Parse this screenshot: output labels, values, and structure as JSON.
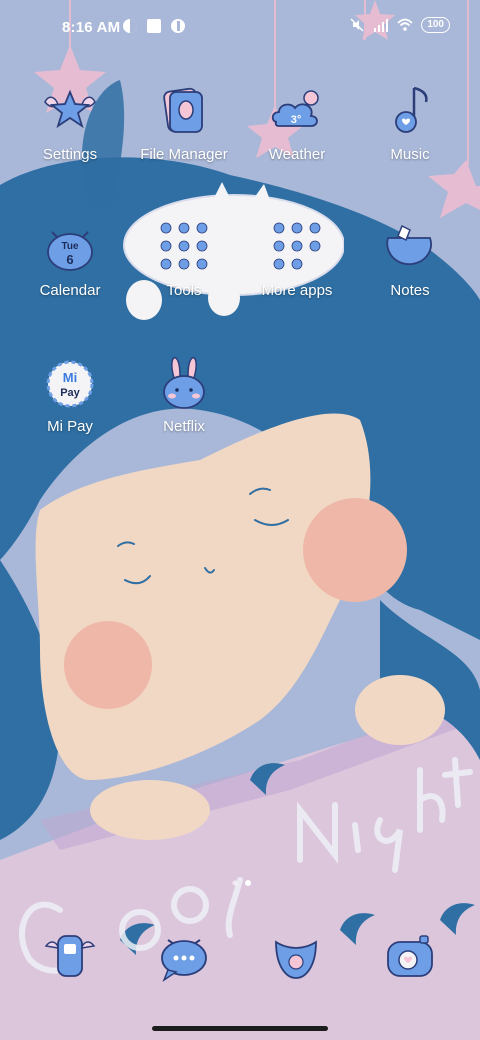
{
  "status_bar": {
    "time": "8:16 AM",
    "battery": "100"
  },
  "apps": [
    {
      "label": "Settings",
      "icon": "wing-star-icon"
    },
    {
      "label": "File Manager",
      "icon": "file-manager-icon"
    },
    {
      "label": "Weather",
      "icon": "weather-cloud-icon",
      "temp": "3°"
    },
    {
      "label": "Music",
      "icon": "music-note-icon"
    },
    {
      "label": "Calendar",
      "icon": "calendar-icon",
      "day": "Tue",
      "date": "6"
    },
    {
      "label": "Tools",
      "icon": "tools-folder-icon"
    },
    {
      "label": "More apps",
      "icon": "more-apps-folder-icon"
    },
    {
      "label": "Notes",
      "icon": "notes-cloud-icon"
    },
    {
      "label": "Mi Pay",
      "icon": "mi-pay-icon",
      "mi": "Mi",
      "pay": "Pay"
    },
    {
      "label": "Netflix",
      "icon": "bunny-icon"
    }
  ],
  "dock": [
    {
      "name": "phone",
      "icon": "phone-icon"
    },
    {
      "name": "messages",
      "icon": "message-bubble-icon"
    },
    {
      "name": "browser",
      "icon": "browser-bib-icon"
    },
    {
      "name": "camera",
      "icon": "camera-icon"
    }
  ],
  "wallpaper_text": "Good Night",
  "colors": {
    "sky": "#a9b8d8",
    "hair": "#2f6fa3",
    "skin": "#f1d8c4",
    "blush": "#efb7a7",
    "floor": "#dcc6dc",
    "star": "#e6bcd2",
    "icon_blue": "#6d9ee6"
  }
}
